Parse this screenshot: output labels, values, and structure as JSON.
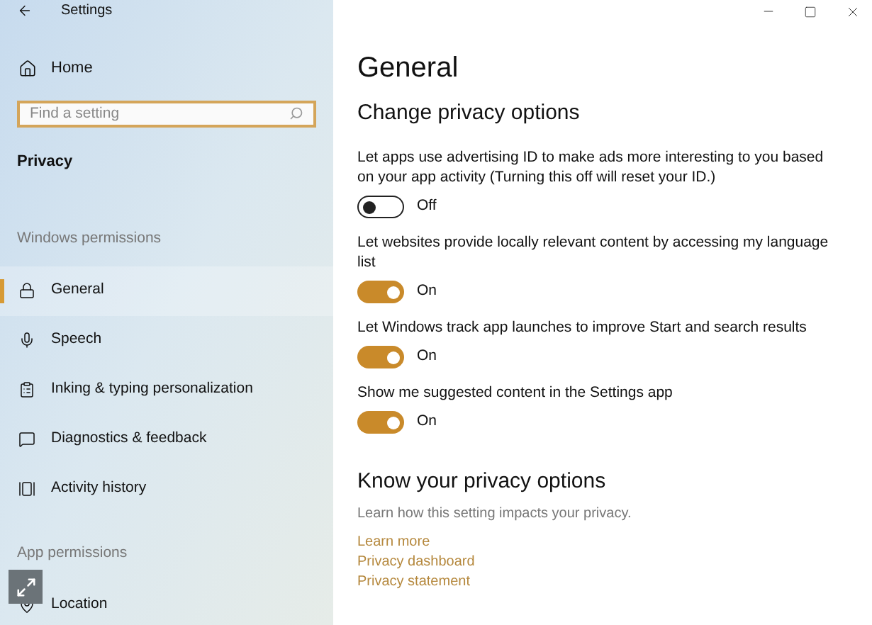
{
  "window": {
    "title": "Settings"
  },
  "sidebar": {
    "home": "Home",
    "search": {
      "placeholder": "Find a setting"
    },
    "section": "Privacy",
    "groups": [
      {
        "label": "Windows permissions",
        "items": [
          {
            "label": "General",
            "kind": "lock",
            "selected": true
          },
          {
            "label": "Speech",
            "kind": "speech",
            "selected": false
          },
          {
            "label": "Inking & typing personalization",
            "kind": "clipboard",
            "selected": false
          },
          {
            "label": "Diagnostics & feedback",
            "kind": "feedback",
            "selected": false
          },
          {
            "label": "Activity history",
            "kind": "activity",
            "selected": false
          }
        ]
      },
      {
        "label": "App permissions",
        "items": [
          {
            "label": "Location",
            "kind": "location",
            "selected": false
          }
        ]
      }
    ]
  },
  "main": {
    "title": "General",
    "subtitle": "Change privacy options",
    "options": [
      {
        "text": "Let apps use advertising ID to make ads more interesting to you based on your app activity (Turning this off will reset your ID.)",
        "on": false,
        "state": "Off"
      },
      {
        "text": "Let websites provide locally relevant content by accessing my language list",
        "on": true,
        "state": "On"
      },
      {
        "text": "Let Windows track app launches to improve Start and search results",
        "on": true,
        "state": "On"
      },
      {
        "text": "Show me suggested content in the Settings app",
        "on": true,
        "state": "On"
      }
    ],
    "know": {
      "title": "Know your privacy options",
      "text": "Learn how this setting impacts your privacy.",
      "links": [
        "Learn more",
        "Privacy dashboard",
        "Privacy statement"
      ]
    }
  }
}
